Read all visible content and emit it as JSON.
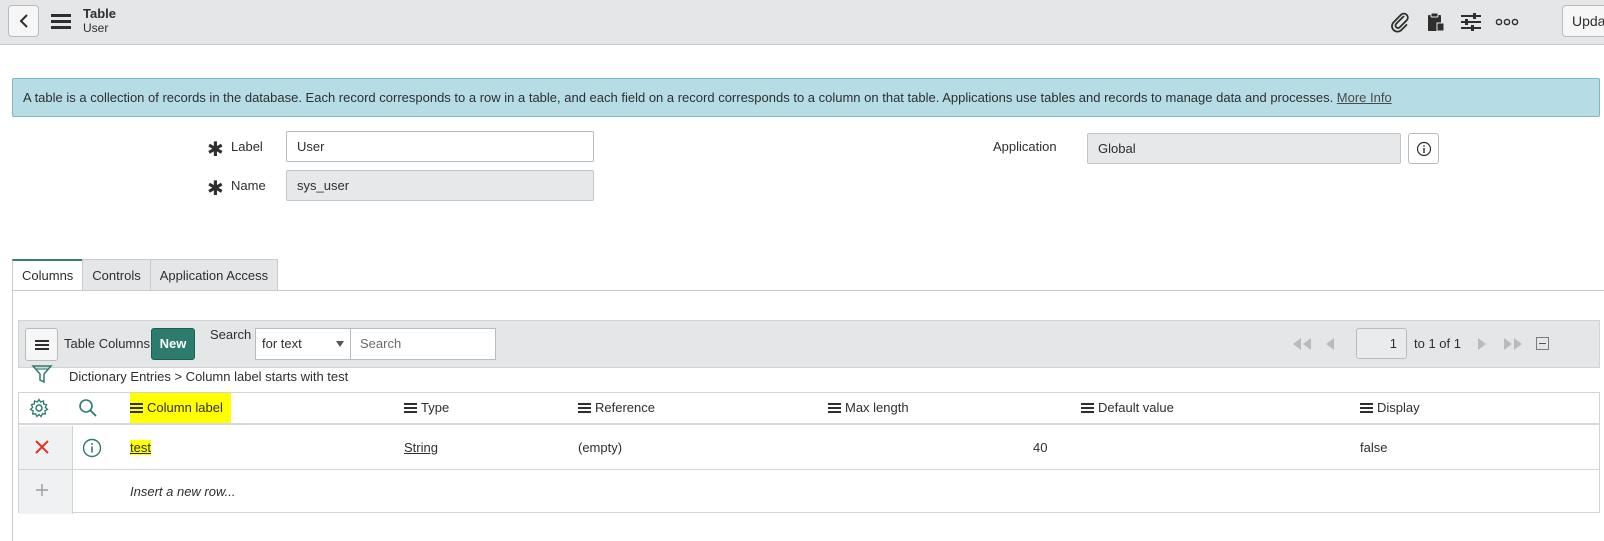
{
  "header": {
    "title": "Table",
    "subtitle": "User",
    "update_label": "Update"
  },
  "banner": {
    "text": "A table is a collection of records in the database. Each record corresponds to a row in a table, and each field on a record corresponds to a column on that table. Applications use tables and records to manage data and processes. ",
    "link": "More Info"
  },
  "form": {
    "label_label": "Label",
    "label_value": "User",
    "name_label": "Name",
    "name_value": "sys_user",
    "application_label": "Application",
    "application_value": "Global"
  },
  "tabs": [
    {
      "label": "Columns"
    },
    {
      "label": "Controls"
    },
    {
      "label": "Application Access"
    }
  ],
  "list": {
    "title": "Table Columns",
    "new_label": "New",
    "search_label": "Search",
    "search_mode": "for text",
    "search_placeholder": "Search",
    "page": "1",
    "page_of": "to 1 of 1",
    "breadcrumb": "Dictionary Entries  >  Column label starts with test",
    "columns": [
      "Column label",
      "Type",
      "Reference",
      "Max length",
      "Default value",
      "Display"
    ],
    "rows": [
      {
        "column_label": "test",
        "type": "String",
        "reference": "(empty)",
        "max_length": "40",
        "default_value": "",
        "display": "false"
      }
    ],
    "insert_row": "Insert a new row..."
  },
  "colors": {
    "accent": "#2b7c6e",
    "banner": "#b6dde5",
    "highlight": "#ffff00",
    "delete": "#e0352b"
  }
}
